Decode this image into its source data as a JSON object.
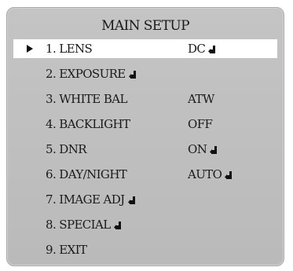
{
  "menu": {
    "title": "MAIN SETUP",
    "items": [
      {
        "label": "1. LENS",
        "value": "DC",
        "label_icon": "",
        "value_icon": "enter-icon",
        "selected": true
      },
      {
        "label": "2. EXPOSURE",
        "value": "",
        "label_icon": "enter-icon",
        "value_icon": "",
        "selected": false
      },
      {
        "label": "3. WHITE BAL",
        "value": "ATW",
        "label_icon": "",
        "value_icon": "",
        "selected": false
      },
      {
        "label": "4. BACKLIGHT",
        "value": "OFF",
        "label_icon": "",
        "value_icon": "",
        "selected": false
      },
      {
        "label": "5. DNR",
        "value": "ON",
        "label_icon": "",
        "value_icon": "enter-icon",
        "selected": false
      },
      {
        "label": "6. DAY/NIGHT",
        "value": "AUTO",
        "label_icon": "",
        "value_icon": "enter-icon",
        "selected": false
      },
      {
        "label": "7. IMAGE ADJ",
        "value": "",
        "label_icon": "enter-icon",
        "value_icon": "",
        "selected": false
      },
      {
        "label": "8. SPECIAL",
        "value": "",
        "label_icon": "enter-icon",
        "value_icon": "",
        "selected": false
      },
      {
        "label": "9. EXIT",
        "value": "",
        "label_icon": "",
        "value_icon": "",
        "selected": false
      }
    ]
  },
  "colors": {
    "panel": "#c0c0c0",
    "selection": "#ffffff",
    "text": "#1a1a1a"
  }
}
